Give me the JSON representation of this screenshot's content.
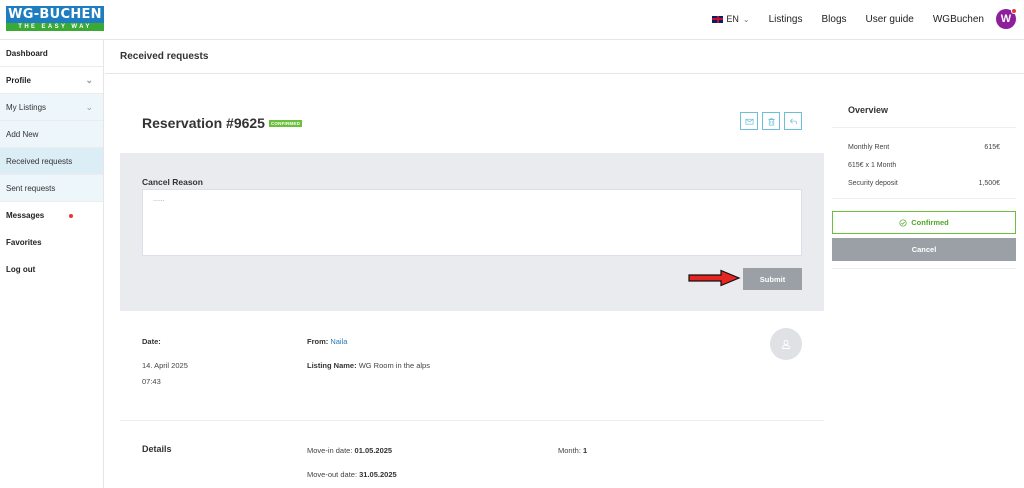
{
  "header": {
    "logo_top": "WG-BUCHEN",
    "logo_bottom": "THE EASY WAY",
    "language": "EN",
    "nav": [
      "Listings",
      "Blogs",
      "User guide",
      "WGBuchen"
    ],
    "avatar_letter": "W",
    "brand_color": "#1e7dc1",
    "avatar_color": "#8e1e9c"
  },
  "sidebar": {
    "items": [
      {
        "label": "Dashboard"
      },
      {
        "label": "Profile"
      },
      {
        "label": "My Listings"
      },
      {
        "label": "Add New"
      },
      {
        "label": "Received requests"
      },
      {
        "label": "Sent requests"
      },
      {
        "label": "Messages"
      },
      {
        "label": "Favorites"
      },
      {
        "label": "Log out"
      }
    ]
  },
  "page": {
    "title": "Received requests"
  },
  "reservation": {
    "title": "Reservation #9625",
    "status_badge": "CONFIRMED",
    "cancel_label": "Cancel Reason",
    "cancel_value": "......",
    "submit_label": "Submit",
    "date_label": "Date:",
    "date_value": "14. April 2025",
    "time_value": "07:43",
    "from_label": "From:",
    "from_value": "Naila",
    "listing_label": "Listing Name:",
    "listing_value": "WG Room in the alps",
    "details_label": "Details",
    "movein_label": "Move-in date:",
    "movein_value": "01.05.2025",
    "moveout_label": "Move-out date:",
    "moveout_value": "31.05.2025",
    "month_label": "Month:",
    "month_value": "1"
  },
  "overview": {
    "title": "Overview",
    "rows": [
      {
        "label": "Monthly Rent",
        "value": "615€"
      },
      {
        "label": "615€ x 1 Month",
        "value": ""
      },
      {
        "label": "Security deposit",
        "value": "1,500€"
      }
    ],
    "confirmed_label": "Confirmed",
    "cancel_label": "Cancel"
  }
}
